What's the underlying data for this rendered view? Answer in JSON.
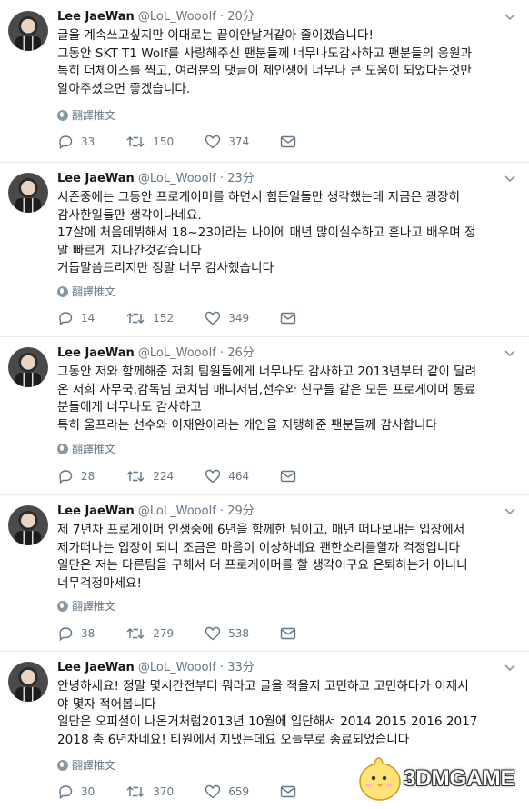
{
  "tweets": [
    {
      "name": "Lee JaeWan",
      "handle": "@LoL_Wooolf",
      "time": "20分",
      "lines": [
        "글을 계속쓰고싶지만 이대로는 끝이안날거같아 줄이겠습니다!",
        "그동안 SKT T1 Wolf를 사랑해주신 팬분들께 너무나도감사하고 팬분들의 응원과",
        "특히 더체이스를 찍고, 여러분의 댓글이 제인생에 너무나 큰 도움이 되었다는것만",
        "알아주셨으면 좋겠습니다."
      ],
      "translate": "翻譯推文",
      "replies": "33",
      "retweets": "150",
      "likes": "374"
    },
    {
      "name": "Lee JaeWan",
      "handle": "@LoL_Wooolf",
      "time": "23分",
      "lines": [
        "시즌중에는 그동안 프로게이머를 하면서 힘든일들만 생각했는데 지금은 굉장히",
        "감사한일들만 생각이나네요.",
        "17살에 처음데뷔해서 18~23이라는 나이에 매년 많이실수하고 혼나고 배우며 정",
        "말 빠르게 지나간것같습니다",
        "거듭말씀드리지만 정말 너무 감사했습니다"
      ],
      "translate": "翻譯推文",
      "replies": "14",
      "retweets": "152",
      "likes": "349"
    },
    {
      "name": "Lee JaeWan",
      "handle": "@LoL_Wooolf",
      "time": "26分",
      "lines": [
        "그동안 저와 함께해준 저희 팀원들에게 너무나도 감사하고 2013년부터 같이 달려",
        "온 저희 사무국,감독님 코치님 매니저님,선수와 친구들 같은 모든 프로게이머 동료",
        "분들에게 너무나도 감사하고",
        "특히 울프라는 선수와 이재완이라는 개인을 지탱해준 팬분들께 감사합니다"
      ],
      "translate": "翻譯推文",
      "replies": "28",
      "retweets": "224",
      "likes": "464"
    },
    {
      "name": "Lee JaeWan",
      "handle": "@LoL_Wooolf",
      "time": "29分",
      "lines": [
        "제 7년차 프로게이머 인생중에 6년을 함께한 팀이고, 매년 떠나보내는 입장에서",
        "제가떠나는 입장이 되니 조금은 마음이 이상하네요 괜한소리를할까 걱정입니다",
        "일단은 저는 다른팀을 구해서 더 프로게이머를 할 생각이구요 은퇴하는거 아니니",
        "너무걱정마세요!"
      ],
      "translate": "翻譯推文",
      "replies": "38",
      "retweets": "279",
      "likes": "538"
    },
    {
      "name": "Lee JaeWan",
      "handle": "@LoL_Wooolf",
      "time": "33分",
      "lines": [
        "안녕하세요! 정말 몇시간전부터 뭐라고 글을 적을지 고민하고 고민하다가 이제서",
        "야 몇자 적어봅니다",
        "일단은 오피셜이 나온거처럼2013년 10월에 입단해서 2014 2015 2016 2017",
        "2018 총 6년차네요! 티원에서 지냈는데요 오늘부로 종료되었습니다"
      ],
      "translate": "翻譯推文",
      "replies": "30",
      "retweets": "370",
      "likes": "659"
    }
  ],
  "watermark": {
    "text": "3DMGAME"
  },
  "colors": {
    "text": "#14171a",
    "muted": "#657786",
    "border": "#e6ecf0"
  }
}
